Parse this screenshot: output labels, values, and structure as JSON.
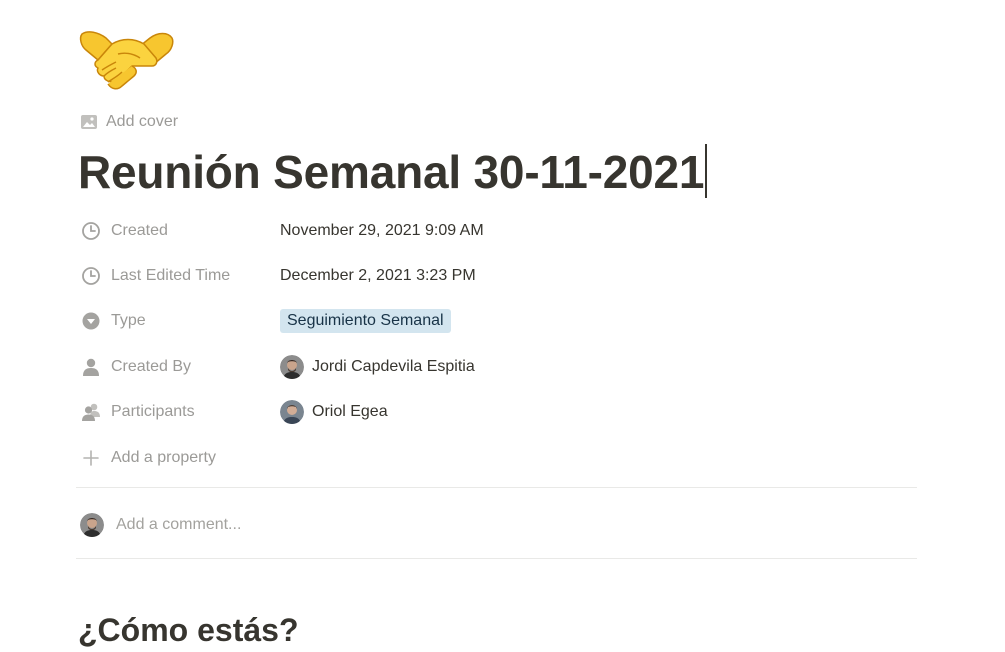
{
  "page": {
    "icon": "handshake-emoji",
    "add_cover_label": "Add cover",
    "title": "Reunión Semanal 30-11-2021"
  },
  "properties": [
    {
      "name": "Created",
      "icon": "clock-icon",
      "value": "November 29, 2021 9:09 AM"
    },
    {
      "name": "Last Edited Time",
      "icon": "clock-icon",
      "value": "December 2, 2021 3:23 PM"
    },
    {
      "name": "Type",
      "icon": "select-icon",
      "value": "Seguimiento Semanal",
      "tag_color": "#d3e5ef"
    },
    {
      "name": "Created By",
      "icon": "person-icon",
      "value": "Jordi Capdevila Espitia"
    },
    {
      "name": "Participants",
      "icon": "people-icon",
      "value": "Oriol Egea"
    }
  ],
  "add_property_label": "Add a property",
  "comment": {
    "placeholder": "Add a comment..."
  },
  "content": {
    "heading": "¿Cómo estás?"
  }
}
